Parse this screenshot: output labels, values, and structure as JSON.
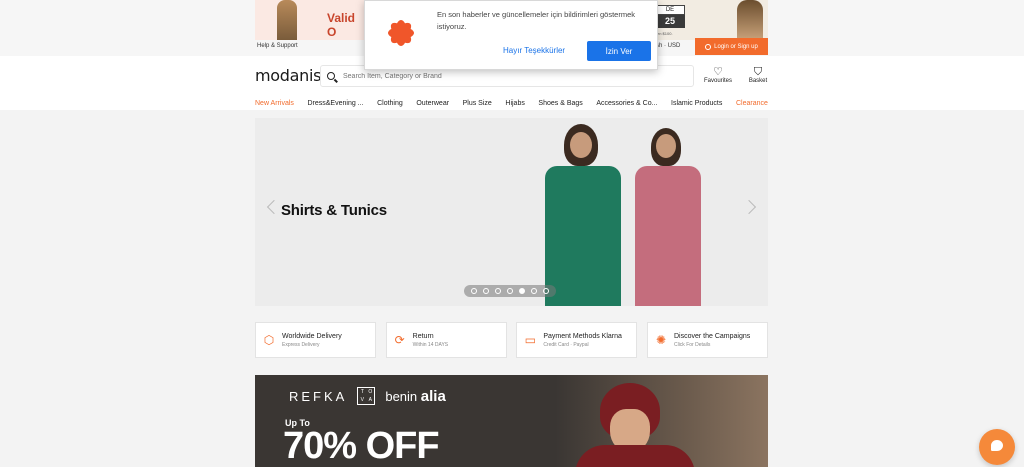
{
  "top": {
    "promo_left_text": "Valid O",
    "help_label": "Help & Support",
    "promo_right_code": "DE",
    "promo_right_number": "25",
    "promo_right_small": "en $100.",
    "currency_label": "sh · USD",
    "login_label": "Login or Sign up"
  },
  "header": {
    "logo_text": "modanisa",
    "search_placeholder": "Search Item, Category or Brand",
    "favourites_label": "Favourites",
    "basket_label": "Basket"
  },
  "nav": {
    "items": [
      "New Arrivals",
      "Dress&Evening ...",
      "Clothing",
      "Outerwear",
      "Plus Size",
      "Hijabs",
      "Shoes & Bags",
      "Accessories & Co...",
      "Islamic Products",
      "Clearance"
    ],
    "accent_color": "#f26b2c"
  },
  "hero": {
    "title": "Shirts & Tunics",
    "slide_count": 7,
    "active_slide": 5
  },
  "features": [
    {
      "title": "Worldwide Delivery",
      "subtitle": "Express Delivery",
      "icon": "box-icon"
    },
    {
      "title": "Return",
      "subtitle": "Within 14 DAYS",
      "icon": "return-icon"
    },
    {
      "title": "Payment Methods Klarna",
      "subtitle": "Credit Card · Paypal",
      "icon": "payment-icon"
    },
    {
      "title": "Discover the Campaigns",
      "subtitle": "Click For Details",
      "icon": "campaign-icon"
    }
  ],
  "banner": {
    "brand1": "REFKA",
    "brand_box": [
      "T",
      "O",
      "V",
      "A"
    ],
    "brand2_prefix": "benin",
    "brand2_name": "alia",
    "upto": "Up To",
    "discount": "70% OFF"
  },
  "notification": {
    "message": "En son haberler ve güncellemeler için bildirimleri göstermek istiyoruz.",
    "deny_label": "Hayır Teşekkürler",
    "allow_label": "İzin Ver",
    "allow_color": "#1a73e8"
  }
}
